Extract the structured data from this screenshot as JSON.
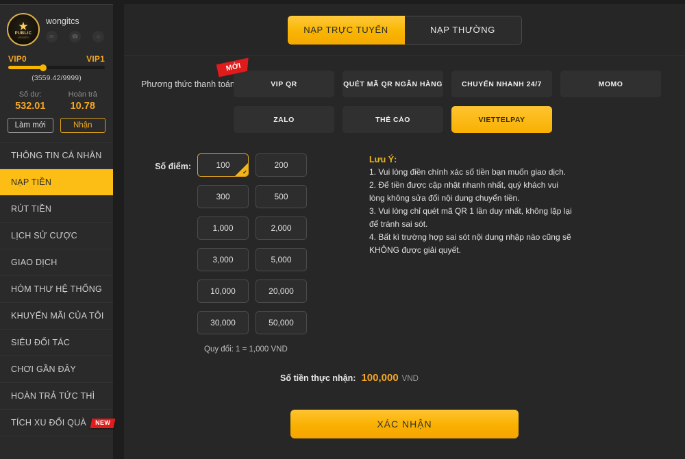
{
  "colors": {
    "accent": "#f5a623",
    "accent_button": "#fcbd14",
    "badge_red": "#e01b1b",
    "panel_bg": "#272727",
    "sidebar_bg": "#2a2a2a"
  },
  "sidebar": {
    "avatar": {
      "star_glyph": "★",
      "label": "PUBLIC",
      "sub_label": "MEMBER"
    },
    "username": "wongitcs",
    "mini_icons": [
      {
        "name": "message-icon",
        "glyph": "✉"
      },
      {
        "name": "headset-icon",
        "glyph": "☎"
      },
      {
        "name": "user-icon",
        "glyph": "☺"
      }
    ],
    "vip": {
      "current_level": "VIP0",
      "next_level": "VIP1",
      "progress_text": "(3559.42/9999)",
      "progress_percent": 36
    },
    "balance": {
      "balance_label": "Số dư:",
      "balance_value": "532.01",
      "rebate_label": "Hoàn trả",
      "rebate_value": "10.78"
    },
    "buttons": {
      "refresh": "Làm mới",
      "claim": "Nhận"
    },
    "menu": [
      {
        "label": "THÔNG TIN CÁ NHÂN",
        "active": false,
        "badge": ""
      },
      {
        "label": "NẠP TIỀN",
        "active": true,
        "badge": ""
      },
      {
        "label": "RÚT TIỀN",
        "active": false,
        "badge": ""
      },
      {
        "label": "LỊCH SỬ CƯỢC",
        "active": false,
        "badge": ""
      },
      {
        "label": "GIAO DỊCH",
        "active": false,
        "badge": ""
      },
      {
        "label": "HÒM THƯ HỆ THỐNG",
        "active": false,
        "badge": ""
      },
      {
        "label": "KHUYẾN MÃI CỦA TÔI",
        "active": false,
        "badge": ""
      },
      {
        "label": "SIÊU ĐỐI TÁC",
        "active": false,
        "badge": ""
      },
      {
        "label": "CHƠI GẦN ĐÂY",
        "active": false,
        "badge": ""
      },
      {
        "label": "HOÀN TRẢ TỨC THÌ",
        "active": false,
        "badge": ""
      },
      {
        "label": "TÍCH XU ĐỔI QUÀ",
        "active": false,
        "badge": "NEW"
      }
    ]
  },
  "main": {
    "tabs": [
      {
        "label": "NẠP TRỰC TUYẾN",
        "active": true
      },
      {
        "label": "NẠP THƯỜNG",
        "active": false
      }
    ],
    "payment": {
      "label": "Phương thức thanh toán",
      "methods": [
        {
          "label": "VIP QR",
          "selected": false,
          "ribbon": "MỚI"
        },
        {
          "label": "QUÉT MÃ QR NGÂN HÀNG",
          "selected": false,
          "ribbon": ""
        },
        {
          "label": "CHUYỂN NHANH 24/7",
          "selected": false,
          "ribbon": ""
        },
        {
          "label": "MOMO",
          "selected": false,
          "ribbon": ""
        },
        {
          "label": "ZALO",
          "selected": false,
          "ribbon": ""
        },
        {
          "label": "THẺ CÀO",
          "selected": false,
          "ribbon": ""
        },
        {
          "label": "VIETTELPAY",
          "selected": true,
          "ribbon": ""
        }
      ]
    },
    "amount": {
      "label": "Số điểm:",
      "options": [
        {
          "label": "100",
          "selected": true
        },
        {
          "label": "200",
          "selected": false
        },
        {
          "label": "300",
          "selected": false
        },
        {
          "label": "500",
          "selected": false
        },
        {
          "label": "1,000",
          "selected": false
        },
        {
          "label": "2,000",
          "selected": false
        },
        {
          "label": "3,000",
          "selected": false
        },
        {
          "label": "5,000",
          "selected": false
        },
        {
          "label": "10,000",
          "selected": false
        },
        {
          "label": "20,000",
          "selected": false
        },
        {
          "label": "30,000",
          "selected": false
        },
        {
          "label": "50,000",
          "selected": false
        }
      ],
      "rate_text": "Quy đổi: 1 = 1,000 VND"
    },
    "notes": {
      "title": "Lưu Ý:",
      "lines": [
        "1. Vui lòng điền chính xác số tiền bạn muốn giao dịch.",
        "2. Để tiền được cập nhật nhanh nhất, quý khách vui lòng không sửa đổi nội dung chuyển tiền.",
        "3. Vui lòng chỉ quét mã QR 1 lần duy nhất, không lặp lại để tránh sai sót.",
        "4. Bất kì trường hợp sai sót nội dung nhập nào cũng sẽ KHÔNG được giải quyết."
      ]
    },
    "total": {
      "label": "Số tiền thực nhận:",
      "value": "100,000",
      "unit": "VND"
    },
    "confirm_button": "XÁC NHẬN"
  }
}
